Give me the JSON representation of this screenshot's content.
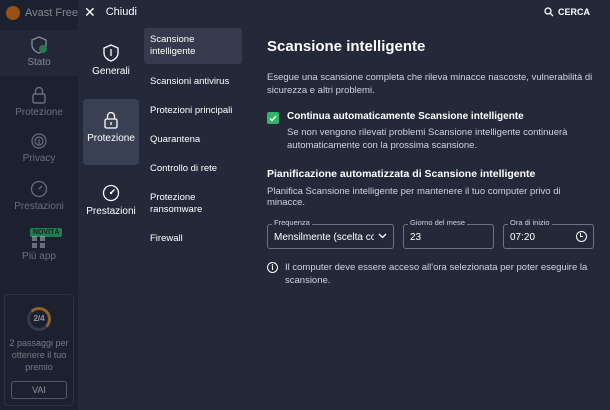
{
  "background_app": {
    "brand": "Avast Free A",
    "nav": [
      {
        "label": "Stato",
        "icon": "shield-check-icon"
      },
      {
        "label": "Protezione",
        "icon": "lock-icon"
      },
      {
        "label": "Privacy",
        "icon": "fingerprint-icon"
      },
      {
        "label": "Prestazioni",
        "icon": "gauge-icon"
      },
      {
        "label": "Più app",
        "icon": "grid-icon"
      }
    ],
    "new_badge": "NOVITÀ",
    "promo": {
      "progress": "2/4",
      "text": "2 passaggi per ottenere il tuo premio",
      "button": "VAI"
    }
  },
  "topbar": {
    "close_label": "Chiudi",
    "search_label": "CERCA"
  },
  "categories": [
    {
      "label": "Generali",
      "icon": "shield-icon"
    },
    {
      "label": "Protezione",
      "icon": "lock-icon"
    },
    {
      "label": "Prestazioni",
      "icon": "speedometer-icon"
    }
  ],
  "subsections": [
    "Scansione intelligente",
    "Scansioni antivirus",
    "Protezioni principali",
    "Quarantena",
    "Controllo di rete",
    "Protezione ransomware",
    "Firewall"
  ],
  "content": {
    "title": "Scansione intelligente",
    "description": "Esegue una scansione completa che rileva minacce nascoste, vulnerabilità di sicurezza e altri problemi.",
    "auto_scan": {
      "label": "Continua automaticamente Scansione intelligente",
      "description": "Se non vengono rilevati problemi Scansione intelligente continuerà automaticamente con la prossima scansione.",
      "checked": true
    },
    "schedule": {
      "title": "Pianificazione automatizzata di Scansione intelligente",
      "description": "Planifica Scansione intelligente per mantenere il tuo computer privo di minacce.",
      "frequency": {
        "label": "Frequenza",
        "value": "Mensilmente (scelta cor"
      },
      "day": {
        "label": "Giorno del mese",
        "value": "23"
      },
      "time": {
        "label": "Ora di inizio",
        "value": "07:20"
      }
    },
    "info": "Il computer deve essere acceso all'ora selezionata per poter eseguire la scansione."
  },
  "colors": {
    "accent_green": "#2fb565",
    "panel_bg": "#24293a"
  }
}
